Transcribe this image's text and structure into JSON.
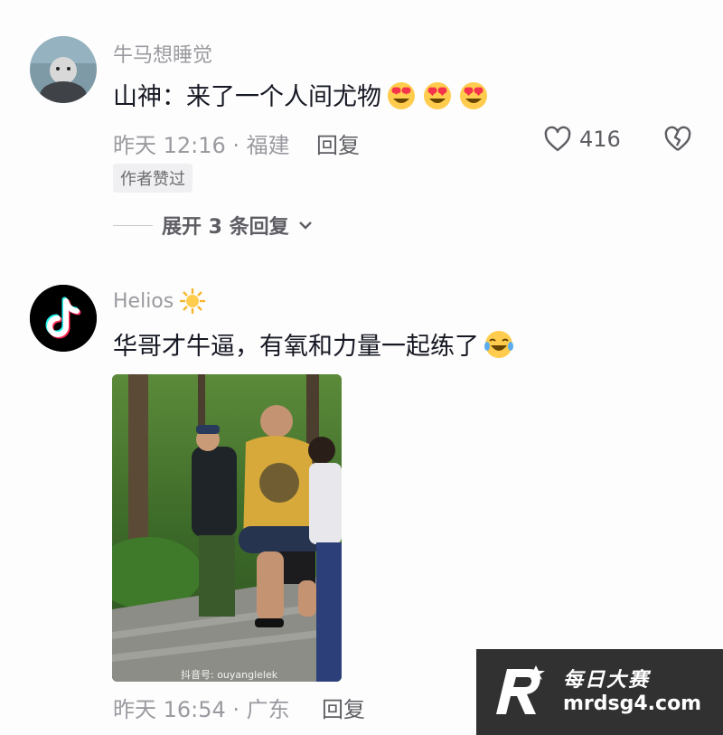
{
  "comments": [
    {
      "username": "牛马想睡觉",
      "text": "山神：来了一个人间尤物",
      "emoji_count": 3,
      "time_location": "昨天 12:16 · 福建",
      "reply_label": "回复",
      "likes": "416",
      "author_badge": "作者赞过",
      "expand_label": "展开 3 条回复"
    },
    {
      "username": "Helios",
      "text": "华哥才牛逼，有氧和力量一起练了",
      "time_location": "昨天 16:54 · 广东",
      "reply_label": "回复",
      "video_watermark": "抖音号: ouyanglelek"
    }
  ],
  "watermark": {
    "line1": "每日大赛",
    "line2": "mrdsg4.com"
  },
  "icons": {
    "like": "heart-outline-icon",
    "dislike": "broken-heart-icon",
    "expand": "chevron-down-icon",
    "emoji_love": "heart-eyes-emoji",
    "emoji_laugh": "tears-of-joy-emoji",
    "sun": "sun-emoji",
    "tiktok": "tiktok-logo-icon"
  },
  "colors": {
    "primary_text": "#161823",
    "secondary_text": "#9a9aa0",
    "accent_red": "#fe2c55"
  }
}
